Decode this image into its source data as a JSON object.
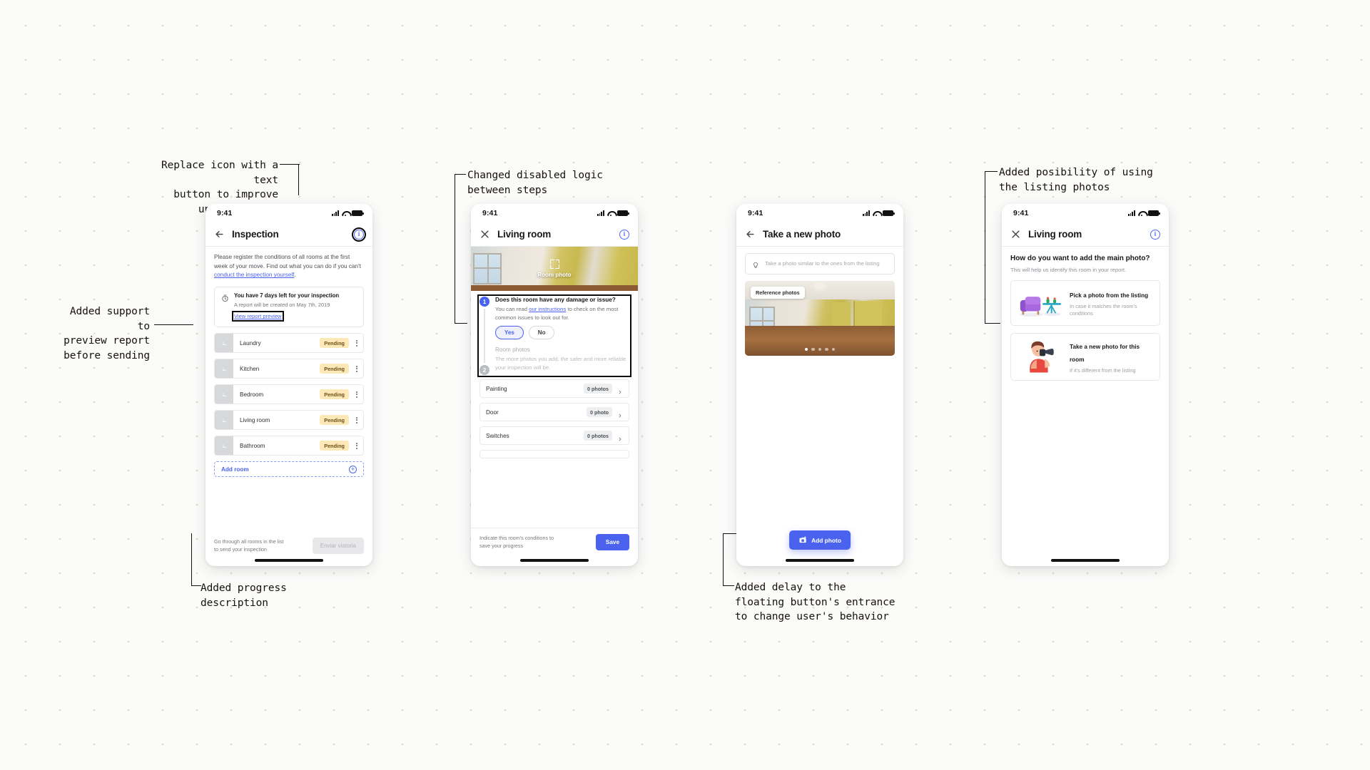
{
  "annotations": [
    {
      "id": "a1",
      "text": "Replace icon with a text\nbutton to improve\nunderstanding"
    },
    {
      "id": "a2",
      "text": "Added support to\npreview report\nbefore sending"
    },
    {
      "id": "a3",
      "text": "Added progress\ndescription"
    },
    {
      "id": "a4",
      "text": "Changed disabled logic\nbetween steps"
    },
    {
      "id": "a5",
      "text": "Added delay to the\nfloating button's entrance\nto change user's behavior"
    },
    {
      "id": "a6",
      "text": "Added posibility of using\nthe listing photos"
    }
  ],
  "status_bar": {
    "time": "9:41"
  },
  "colors": {
    "accent": "#4a62ee",
    "badge_bg": "#fde8b8",
    "badge_text": "#6d5317",
    "link": "#4a62ee"
  },
  "screen1": {
    "nav": {
      "back_icon": "arrow-left-icon",
      "title": "Inspection",
      "action_icon": "info-circle-icon"
    },
    "intro": {
      "text_before": "Please register the conditions of all rooms at the first week of your move. Find out what you can do if you can't ",
      "link": "conduct the inspection yourself",
      "text_after": "."
    },
    "alert": {
      "icon": "timer-icon",
      "title": "You have 7 days left for your inspection",
      "subtitle": "A report will be created on May 7th, 2019",
      "link": "View report preview"
    },
    "rooms": [
      {
        "name": "Laundry",
        "status": "Pending"
      },
      {
        "name": "Kitchen",
        "status": "Pending"
      },
      {
        "name": "Bedroom",
        "status": "Pending"
      },
      {
        "name": "Living room",
        "status": "Pending"
      },
      {
        "name": "Bathroom",
        "status": "Pending"
      }
    ],
    "add_room": {
      "label": "Add room",
      "icon": "plus-circle-icon"
    },
    "footer": {
      "hint": "Go through all rooms in the list to send your inspection",
      "button": "Enviar vistoria"
    }
  },
  "screen2": {
    "nav": {
      "close_icon": "close-icon",
      "title": "Living room",
      "action_icon": "info-circle-icon"
    },
    "hero": {
      "label": "Room photo",
      "icon": "expand-icon"
    },
    "steps": [
      {
        "number": "1",
        "title": "Does this room have any damage or issue?",
        "desc_before": "You can read ",
        "desc_link": "our instructions",
        "desc_after": " to check on the most common issues to look out for.",
        "options": [
          {
            "label": "Yes",
            "selected": true
          },
          {
            "label": "No",
            "selected": false
          }
        ]
      },
      {
        "number": "2",
        "title": "Room photos",
        "desc": "The more photos you add, the safer and more reliable your inspection will be."
      }
    ],
    "items": [
      {
        "name": "Painting",
        "count": "0 photos"
      },
      {
        "name": "Door",
        "count": "0 photo"
      },
      {
        "name": "Switches",
        "count": "0 photos"
      }
    ],
    "footer": {
      "hint": "Indicate this room's conditions to save your progress",
      "button": "Save"
    }
  },
  "screen3": {
    "nav": {
      "back_icon": "arrow-left-icon",
      "title": "Take a new photo"
    },
    "tip": {
      "icon": "lightbulb-icon",
      "text": "Take a photo similar to the ones from the listing"
    },
    "photo": {
      "chip": "Reference photos",
      "dots": 5,
      "active_dot": 1
    },
    "fab": {
      "icon": "camera-plus-icon",
      "label": "Add photo"
    }
  },
  "screen4": {
    "nav": {
      "close_icon": "close-icon",
      "title": "Living room",
      "action_icon": "info-circle-icon"
    },
    "question": "How do you want to add the main photo?",
    "subtitle": "This will help us identify this room in your report.",
    "options": [
      {
        "illustration": "armchair-table-illustration",
        "title": "Pick a photo from the listing",
        "desc": "In case it matches the room's conditions"
      },
      {
        "illustration": "woman-camera-illustration",
        "title": "Take a new photo for this room",
        "desc": "If it's different from the listing"
      }
    ]
  }
}
